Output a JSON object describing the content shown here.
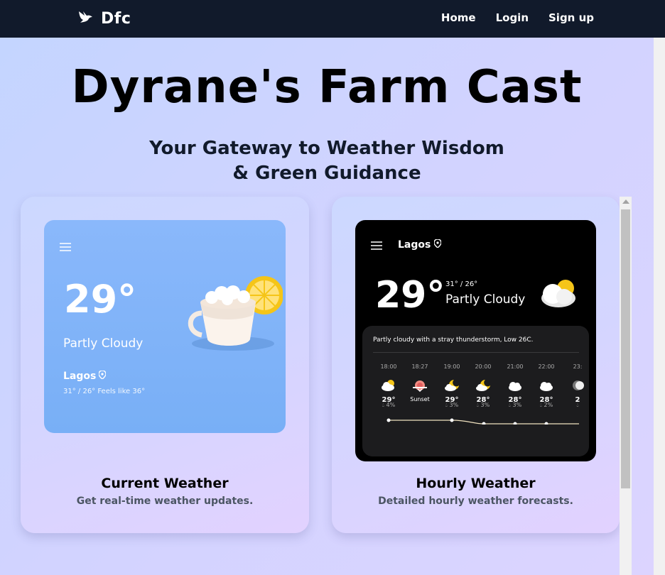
{
  "nav": {
    "brand": "Dfc",
    "links": [
      "Home",
      "Login",
      "Sign up"
    ]
  },
  "hero": {
    "title": "Dyrane's Farm Cast",
    "subtitle_line1": "Your Gateway to Weather Wisdom",
    "subtitle_line2": "& Green Guidance"
  },
  "cards": [
    {
      "title": "Current Weather",
      "description": "Get real-time weather updates.",
      "preview": {
        "temp": "29°",
        "condition": "Partly Cloudy",
        "city": "Lagos",
        "range": "31° / 26° Feels like 36°"
      }
    },
    {
      "title": "Hourly Weather",
      "description": "Detailed hourly weather forecasts.",
      "preview": {
        "city": "Lagos",
        "temp": "29°",
        "range": "31° / 26°",
        "condition": "Partly Cloudy",
        "summary": "Partly cloudy with a stray thunderstorm, Low 26C.",
        "hours": [
          {
            "time": "18:00",
            "icon": "cloud-sun-icon",
            "temp": "29°",
            "rain": "4%"
          },
          {
            "time": "18:27",
            "icon": "sunset-icon",
            "temp": "Sunset",
            "rain": ""
          },
          {
            "time": "19:00",
            "icon": "cloud-moon-icon",
            "temp": "29°",
            "rain": "3%"
          },
          {
            "time": "20:00",
            "icon": "cloud-moon-icon",
            "temp": "28°",
            "rain": "3%"
          },
          {
            "time": "21:00",
            "icon": "cloud-icon",
            "temp": "28°",
            "rain": "3%"
          },
          {
            "time": "22:00",
            "icon": "cloud-icon",
            "temp": "28°",
            "rain": "2%"
          },
          {
            "time": "23:",
            "icon": "moon-icon",
            "temp": "2",
            "rain": ""
          }
        ]
      }
    }
  ],
  "colors": {
    "nav_bg": "#111a2b",
    "accent_sun": "#f5c518",
    "phone_sky": "#7ab0f8"
  }
}
